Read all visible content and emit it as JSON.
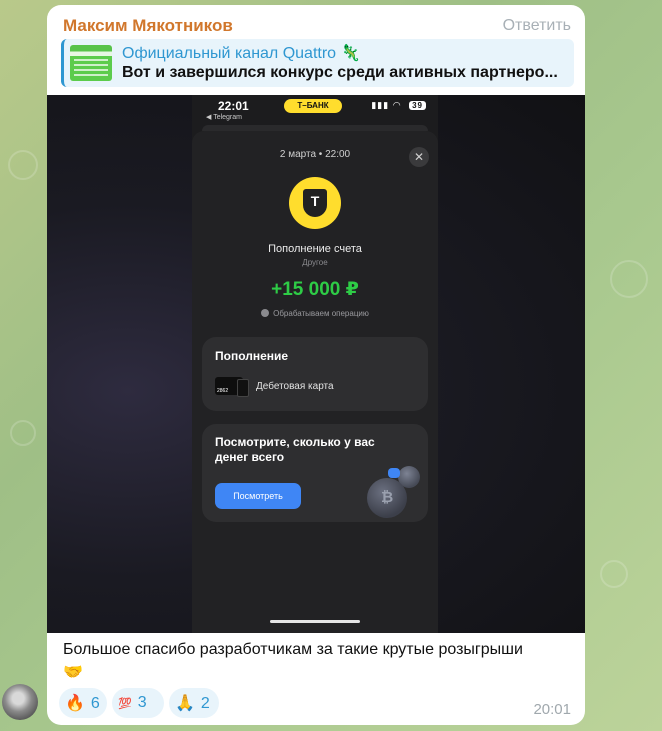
{
  "message": {
    "sender": "Максим Мякотников",
    "reply_button": "Ответить",
    "quote": {
      "title": "Официальный канал Quattro 🦎",
      "text": "Вот и завершился конкурс среди активных партнеро..."
    },
    "caption": "Большое спасибо разработчикам за такие крутые розыгрыши",
    "caption_emoji": "🤝",
    "time": "20:01",
    "reactions": [
      {
        "emoji": "🔥",
        "count": "6"
      },
      {
        "emoji": "💯",
        "count": "3"
      },
      {
        "emoji": "🙏",
        "count": "2"
      }
    ]
  },
  "screenshot": {
    "status_time": "22:01",
    "back_label": "◀ Telegram",
    "bank_label": "T–БАНК",
    "battery": "39",
    "date": "2 марта • 22:00",
    "close_symbol": "✕",
    "logo_letter": "T",
    "operation_title": "Пополнение счета",
    "operation_sub": "Другое",
    "amount": "+15 000 ₽",
    "status": "Обрабатываем операцию",
    "card_section_title": "Пополнение",
    "card_number": "2862",
    "card_type": "Дебетовая карта",
    "promo_title": "Посмотрите, сколько у вас денег всего",
    "promo_button": "Посмотреть",
    "coin_symbol": "₿"
  },
  "colors": {
    "sender": "#d1772c",
    "accent": "#2f97d1",
    "amount_green": "#2ecc46",
    "bank_yellow": "#ffdd2d",
    "button_blue": "#3f86f5"
  }
}
